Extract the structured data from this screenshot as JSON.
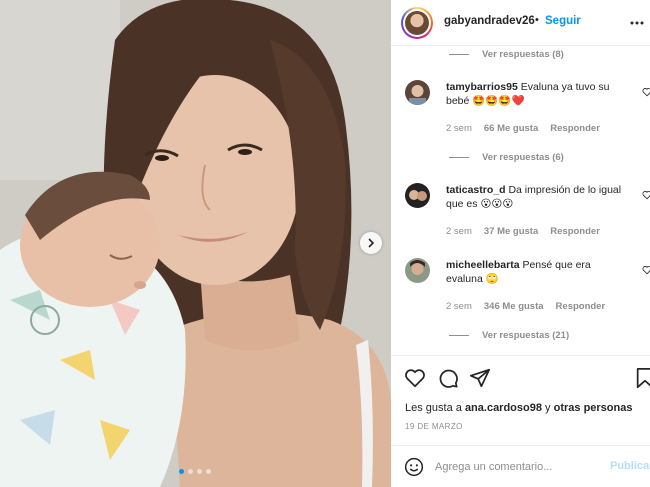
{
  "post": {
    "username": "gabyandradev26",
    "separator": "•",
    "follow_label": "Seguir",
    "image_alt": "",
    "carousel": {
      "dots": 4,
      "active_index": 0
    }
  },
  "comments": [
    {
      "replies_label": "Ver respuestas (8)"
    },
    {
      "username": "tamybarrios95",
      "text": "Evaluna ya tuvo su bebé 🤩🤩🤩❤️",
      "time": "2 sem",
      "likes": "66 Me gusta",
      "reply_label": "Responder",
      "replies_label": "Ver respuestas (6)"
    },
    {
      "username": "taticastro_d",
      "text": "Da impresión de lo igual que es 😮😮😮",
      "time": "2 sem",
      "likes": "37 Me gusta",
      "reply_label": "Responder"
    },
    {
      "username": "micheellebarta",
      "text": "Pensé que era evaluna 🙄",
      "time": "2 sem",
      "likes": "346 Me gusta",
      "reply_label": "Responder",
      "replies_label": "Ver respuestas (21)"
    }
  ],
  "actions": {
    "icons": [
      "heart-icon",
      "comment-icon",
      "share-icon",
      "bookmark-icon"
    ],
    "likes_prefix": "Les gusta a",
    "likes_user": "ana.cardoso98",
    "likes_conj": "y",
    "likes_suffix": "otras personas",
    "date": "19 DE MARZO"
  },
  "comment_box": {
    "placeholder": "Agrega un comentario...",
    "publish_label": "Publicar"
  },
  "colors": {
    "accent": "#0095f6",
    "muted": "#8e8e8e",
    "publish_disabled": "#b2dffc"
  }
}
